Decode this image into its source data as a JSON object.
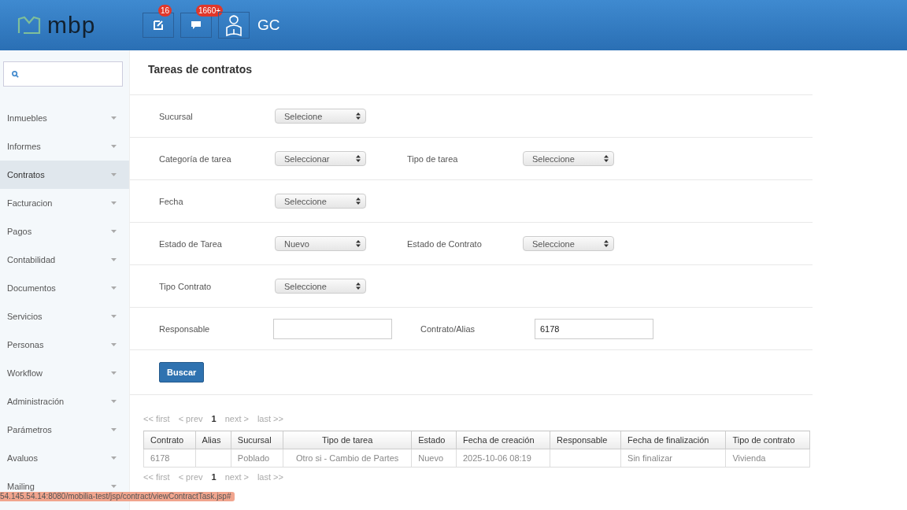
{
  "header": {
    "logo": "mbp",
    "badges": [
      {
        "kind": "edit",
        "count": "16"
      },
      {
        "kind": "chat",
        "count": "1660+"
      }
    ],
    "user": "GC"
  },
  "sidebar": {
    "items": [
      {
        "label": "Inmuebles",
        "selected": false
      },
      {
        "label": "Informes",
        "selected": false
      },
      {
        "label": "Contratos",
        "selected": true
      },
      {
        "label": "Facturacion",
        "selected": false
      },
      {
        "label": "Pagos",
        "selected": false
      },
      {
        "label": "Contabilidad",
        "selected": false
      },
      {
        "label": "Documentos",
        "selected": false
      },
      {
        "label": "Servicios",
        "selected": false
      },
      {
        "label": "Personas",
        "selected": false
      },
      {
        "label": "Workflow",
        "selected": false
      },
      {
        "label": "Administración",
        "selected": false
      },
      {
        "label": "Parámetros",
        "selected": false
      },
      {
        "label": "Avaluos",
        "selected": false
      },
      {
        "label": "Mailing",
        "selected": false
      }
    ]
  },
  "page_title": "Tareas de contratos",
  "form": {
    "rows": [
      {
        "fields": [
          {
            "label": "Sucursal",
            "kind": "select",
            "value": "Selecione"
          }
        ]
      },
      {
        "fields": [
          {
            "label": "Categoría de tarea",
            "kind": "select",
            "value": "Seleccionar"
          },
          {
            "label": "Tipo de tarea",
            "kind": "select",
            "value": "Seleccione"
          }
        ]
      },
      {
        "fields": [
          {
            "label": "Fecha",
            "kind": "select",
            "value": "Seleccione"
          }
        ]
      },
      {
        "fields": [
          {
            "label": "Estado de Tarea",
            "kind": "select",
            "value": "Nuevo"
          },
          {
            "label": "Estado de Contrato",
            "kind": "select",
            "value": "Seleccione"
          }
        ]
      },
      {
        "fields": [
          {
            "label": "Tipo Contrato",
            "kind": "select",
            "value": "Seleccione"
          }
        ]
      },
      {
        "fields": [
          {
            "label": "Responsable",
            "kind": "text"
          },
          {
            "label": "Contrato/Alias",
            "kind": "text",
            "value": "6178"
          }
        ]
      }
    ],
    "button": "Buscar"
  },
  "pager_top": [
    {
      "label": "<< first",
      "selected": false
    },
    {
      "label": "< prev",
      "selected": false
    },
    {
      "label": "1",
      "selected": true
    },
    {
      "label": "next >",
      "selected": false
    },
    {
      "label": "last >>",
      "selected": false
    }
  ],
  "table": {
    "columns": [
      "Contrato",
      "Alias",
      "Sucursal",
      "Tipo de tarea",
      "Estado",
      "Fecha de creación",
      "Responsable",
      "Fecha de finalización",
      "Tipo de contrato"
    ],
    "rows": [
      [
        "6178",
        "",
        "Poblado",
        "Otro si - Cambio de Partes",
        "Nuevo",
        "2025-10-06 08:19",
        "",
        "Sin finalizar",
        "Vivienda"
      ]
    ]
  },
  "pager_bottom": [
    {
      "label": "<< first",
      "selected": false
    },
    {
      "label": "< prev",
      "selected": false
    },
    {
      "label": "1",
      "selected": true
    },
    {
      "label": "next >",
      "selected": false
    },
    {
      "label": "last >>",
      "selected": false
    }
  ],
  "status_bar": "54.145.54.14:8080/mobilia-test/jsp/contract/viewContractTask.jsp#"
}
